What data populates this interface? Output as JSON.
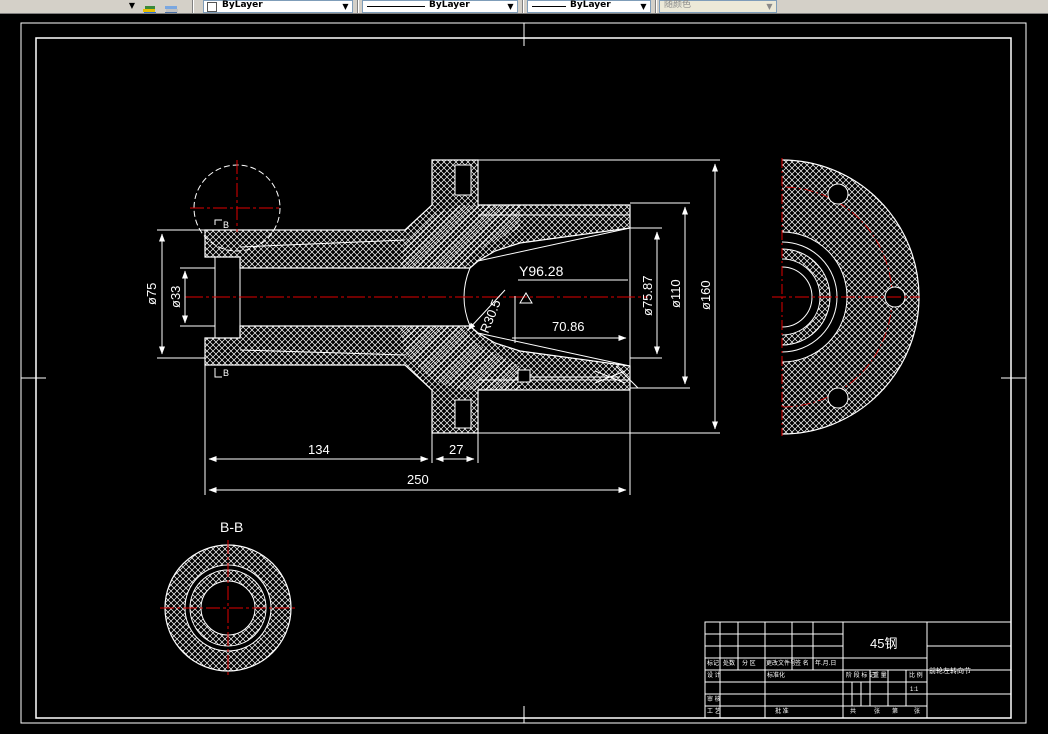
{
  "toolbar": {
    "color_combo": "ByLayer",
    "linetype_combo": "ByLayer",
    "lineweight_combo": "ByLayer",
    "plotstyle_combo": "随颜色"
  },
  "drawing": {
    "section_label": "B-B",
    "section_marker_top": "B",
    "section_marker_bottom": "B",
    "dimensions": {
      "dia_75": "ø75",
      "dia_33": "ø33",
      "y_96_28": "Y96.28",
      "r_30_5": "R30.5",
      "dia_75_87": "ø75.87",
      "dia_110": "ø110",
      "dia_160": "ø160",
      "len_70_86": "70.86",
      "len_134": "134",
      "len_27": "27",
      "len_250": "250"
    }
  },
  "title_block": {
    "material": "45钢",
    "part_name": "前轮左转向节",
    "h_mark": "标记",
    "h_count": "处数",
    "h_zone": "分 区",
    "h_docno": "更改文件号",
    "h_sign": "签 名",
    "h_date": "年.月.日",
    "h_design": "设 计",
    "h_standard": "标准化",
    "h_check": "审 核",
    "h_process": "工 艺",
    "h_approve": "批 准",
    "h_stage": "阶 段 标 记",
    "h_weight": "重 量",
    "h_scale": "比 例",
    "scale_value": "1:1",
    "h_sheets": "共",
    "h_sheet": "张",
    "h_sheetno": "第",
    "h_sheet2": "张"
  }
}
